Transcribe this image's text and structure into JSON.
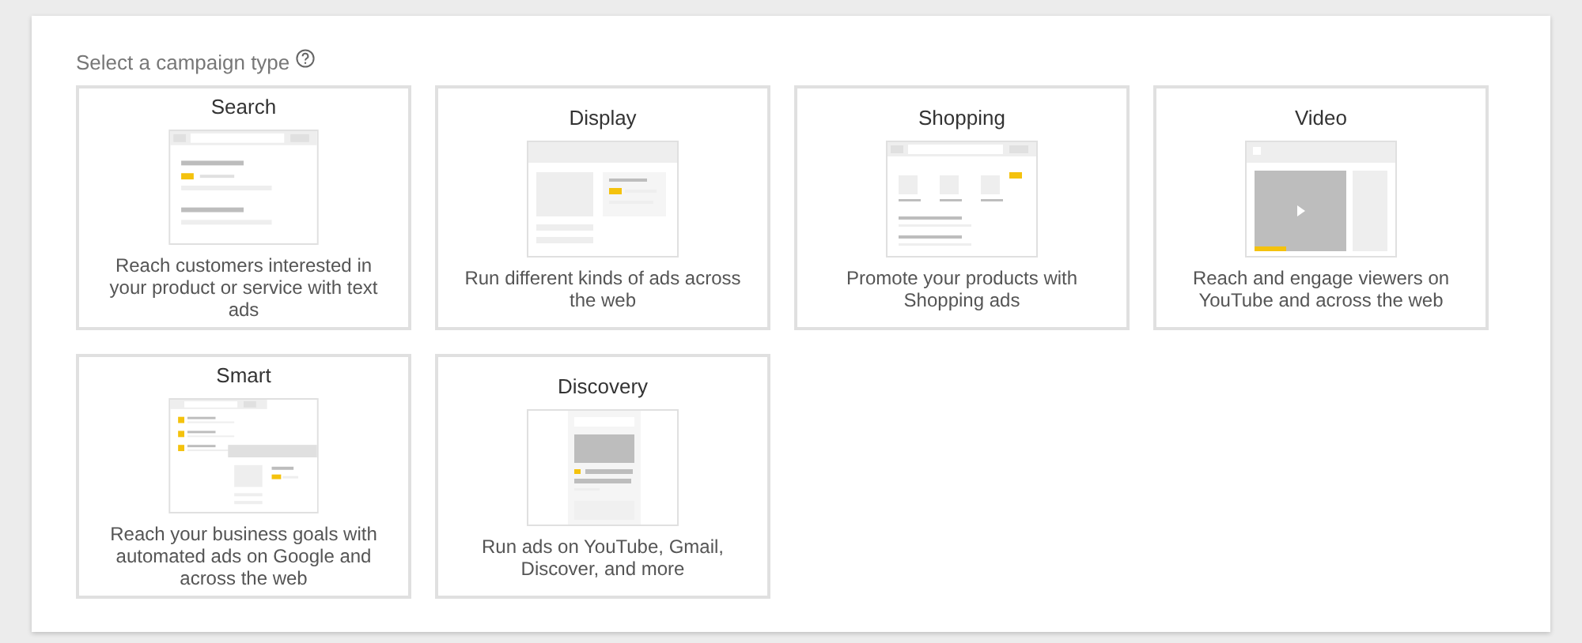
{
  "heading": "Select a campaign type",
  "campaign_types": [
    {
      "kind": "search",
      "title": "Search",
      "description": "Reach customers interested in your product or service with text ads",
      "selected": false
    },
    {
      "kind": "display",
      "title": "Display",
      "description": "Run different kinds of ads across the web",
      "selected": false
    },
    {
      "kind": "shopping",
      "title": "Shopping",
      "description": "Promote your products with Shopping ads",
      "selected": false
    },
    {
      "kind": "video",
      "title": "Video",
      "description": "Reach and engage viewers on YouTube and across the web",
      "selected": false
    },
    {
      "kind": "smart",
      "title": "Smart",
      "description": "Reach your business goals with automated ads on Google and across the web",
      "selected": false
    },
    {
      "kind": "discovery",
      "title": "Discovery",
      "description": "Run ads on YouTube, Gmail, Discover, and more",
      "selected": false
    }
  ]
}
